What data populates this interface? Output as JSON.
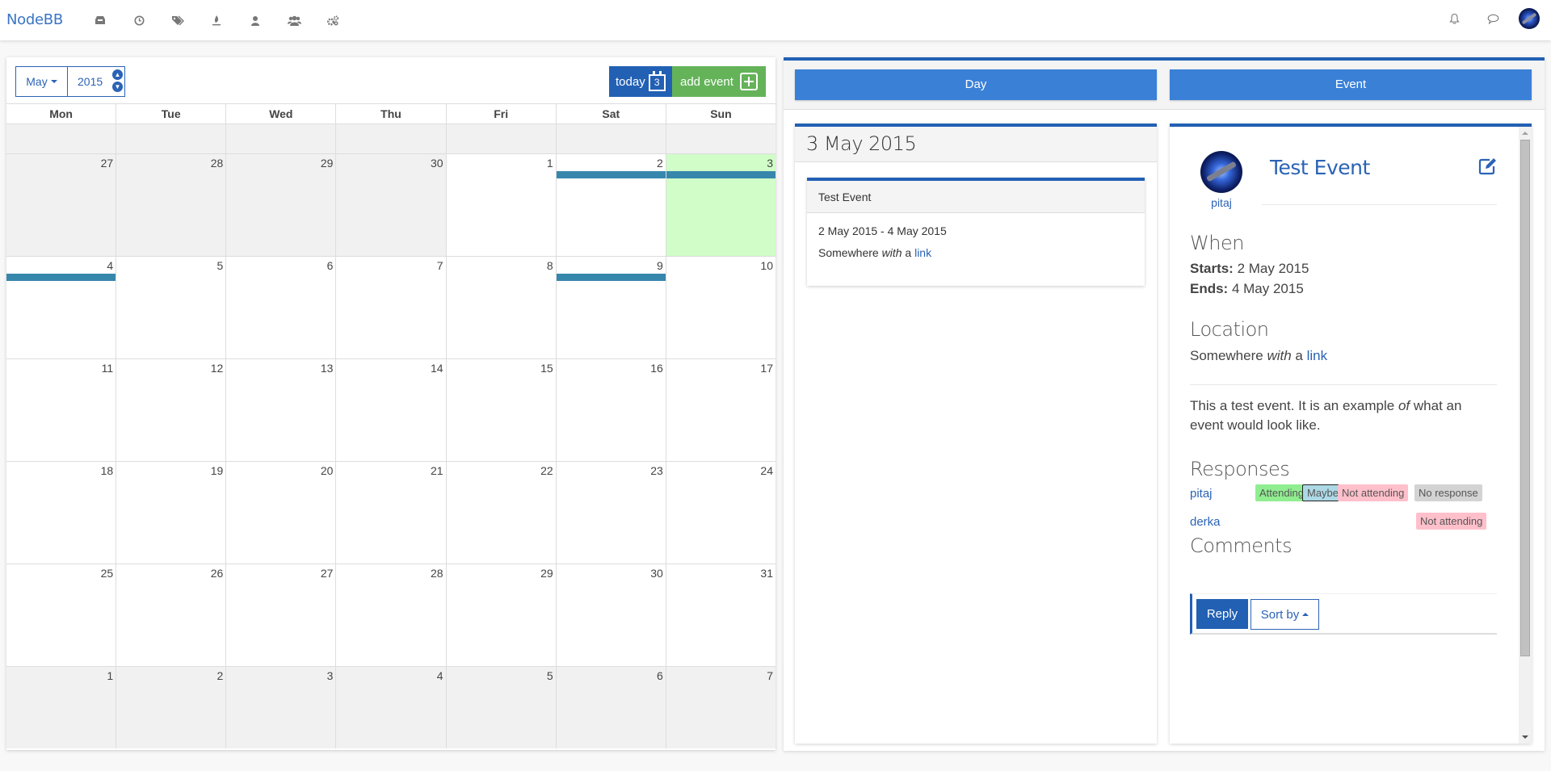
{
  "navbar": {
    "brand": "NodeBB",
    "icons": [
      "inbox-icon",
      "clock-icon",
      "tags-icon",
      "fire-icon",
      "user-icon",
      "users-icon",
      "cogs-icon"
    ],
    "right_icons": [
      "bell-icon",
      "chat-icon",
      "avatar"
    ]
  },
  "calendar": {
    "month": "May",
    "year": "2015",
    "today_label": "today",
    "today_icon_day": "3",
    "add_event_label": "add event",
    "weekdays": [
      "Mon",
      "Tue",
      "Wed",
      "Thu",
      "Fri",
      "Sat",
      "Sun"
    ],
    "weeks": [
      [
        {
          "d": "27",
          "other": true
        },
        {
          "d": "28",
          "other": true
        },
        {
          "d": "29",
          "other": true
        },
        {
          "d": "30",
          "other": true
        },
        {
          "d": "1"
        },
        {
          "d": "2",
          "event": true
        },
        {
          "d": "3",
          "today": true,
          "event": true
        }
      ],
      [
        {
          "d": "4",
          "event": true
        },
        {
          "d": "5"
        },
        {
          "d": "6"
        },
        {
          "d": "7"
        },
        {
          "d": "8"
        },
        {
          "d": "9",
          "event": true
        },
        {
          "d": "10"
        }
      ],
      [
        {
          "d": "11"
        },
        {
          "d": "12"
        },
        {
          "d": "13"
        },
        {
          "d": "14"
        },
        {
          "d": "15"
        },
        {
          "d": "16"
        },
        {
          "d": "17"
        }
      ],
      [
        {
          "d": "18"
        },
        {
          "d": "19"
        },
        {
          "d": "20"
        },
        {
          "d": "21"
        },
        {
          "d": "22"
        },
        {
          "d": "23"
        },
        {
          "d": "24"
        }
      ],
      [
        {
          "d": "25"
        },
        {
          "d": "26"
        },
        {
          "d": "27"
        },
        {
          "d": "28"
        },
        {
          "d": "29"
        },
        {
          "d": "30"
        },
        {
          "d": "31"
        }
      ],
      [
        {
          "d": "1",
          "other": true
        },
        {
          "d": "2",
          "other": true
        },
        {
          "d": "3",
          "other": true
        },
        {
          "d": "4",
          "other": true
        },
        {
          "d": "5",
          "other": true
        },
        {
          "d": "6",
          "other": true
        },
        {
          "d": "7",
          "other": true
        }
      ]
    ],
    "colors": {
      "today_bg": "#d0fdc8",
      "event_bar": "#3787ad",
      "today_btn": "#2260b4",
      "add_btn": "#64b359"
    }
  },
  "tabs": {
    "day": "Day",
    "event": "Event"
  },
  "day_view": {
    "date": "3 May 2015",
    "event": {
      "title": "Test Event",
      "range": "2 May 2015 - 4 May 2015",
      "location_pre": "Somewhere ",
      "location_em": "with",
      "location_mid": " a ",
      "location_link": "link"
    }
  },
  "event_view": {
    "author": "pitaj",
    "title": "Test Event",
    "when_heading": "When",
    "starts_label": "Starts:",
    "starts_value": " 2 May 2015",
    "ends_label": "Ends:",
    "ends_value": " 4 May 2015",
    "location_heading": "Location",
    "location_pre": "Somewhere ",
    "location_em": "with",
    "location_mid": " a ",
    "location_link": "link",
    "desc_pre": "This a test event. It is an example ",
    "desc_em": "of",
    "desc_post": " what an event would look like.",
    "responses_heading": "Responses",
    "responses": [
      {
        "user": "pitaj",
        "options": [
          "Attending",
          "Maybe",
          "Not attending",
          "No response"
        ],
        "selected": "Maybe"
      },
      {
        "user": "derka",
        "status": "Not attending"
      }
    ],
    "comments_heading": "Comments",
    "reply_label": "Reply",
    "sort_label": "Sort by"
  }
}
